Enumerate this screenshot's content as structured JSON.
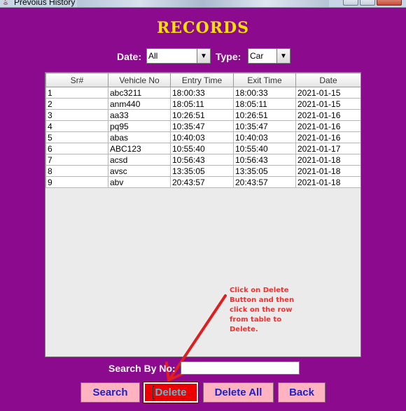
{
  "window": {
    "title": "Prevoius History"
  },
  "heading": "RECORDS",
  "filters": {
    "date_label": "Date:",
    "date_value": "All",
    "type_label": "Type:",
    "type_value": "Car"
  },
  "table": {
    "headers": [
      "Sr#",
      "Vehicle No",
      "Entry Time",
      "Exit Time",
      "Date"
    ],
    "rows": [
      [
        "1",
        "abc3211",
        "18:00:33",
        "18:00:33",
        "2021-01-15"
      ],
      [
        "2",
        "anm440",
        "18:05:11",
        "18:05:11",
        "2021-01-15"
      ],
      [
        "3",
        "aa33",
        "10:26:51",
        "10:26:51",
        "2021-01-16"
      ],
      [
        "4",
        "pq95",
        "10:35:47",
        "10:35:47",
        "2021-01-16"
      ],
      [
        "5",
        "abas",
        "10:40:03",
        "10:40:03",
        "2021-01-16"
      ],
      [
        "6",
        "ABC123",
        "10:55:40",
        "10:55:40",
        "2021-01-17"
      ],
      [
        "7",
        "acsd",
        "10:56:43",
        "10:56:43",
        "2021-01-18"
      ],
      [
        "8",
        "avsc",
        "13:35:05",
        "13:35:05",
        "2021-01-18"
      ],
      [
        "9",
        "abv",
        "20:43:57",
        "20:43:57",
        "2021-01-18"
      ]
    ]
  },
  "annotation": "Click on Delete Button and then click on the row from table to Delete.",
  "search": {
    "label": "Search By No:"
  },
  "buttons": {
    "search": "Search",
    "delete": "Delete",
    "delete_all": "Delete All",
    "back": "Back"
  },
  "colors": {
    "background": "#8b0a8e",
    "heading": "#ffe000",
    "button": "#ffb3c0",
    "delete_button": "#ee0000",
    "button_text": "#1b22c9",
    "annotation": "#ff2a2a"
  }
}
